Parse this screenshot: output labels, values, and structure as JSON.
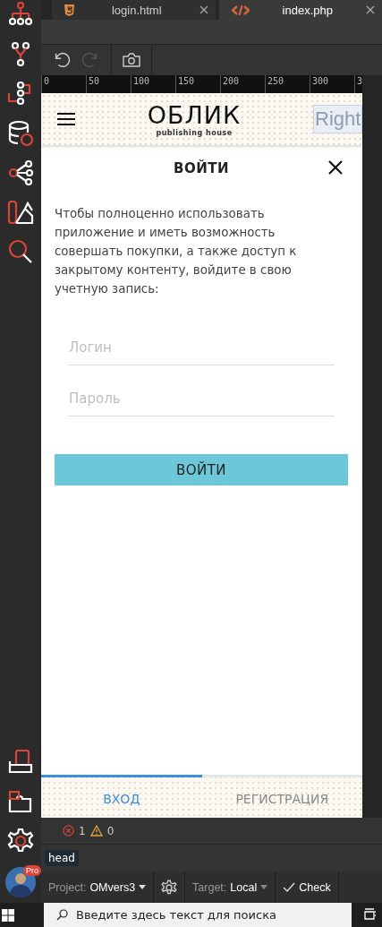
{
  "editor_tabs": [
    {
      "label": "login.html",
      "kind": "html",
      "selected": false
    },
    {
      "label": "index.php",
      "kind": "php",
      "selected": true
    }
  ],
  "history": [
    {
      "kind": "undo",
      "disabled": false
    },
    {
      "kind": "redo",
      "disabled": true
    }
  ],
  "ruler": [
    "0",
    "50",
    "100",
    "150",
    "200",
    "250",
    "300",
    "3"
  ],
  "preview": {
    "header": {
      "logo": "ОБЛИК",
      "tagline": "publishing house",
      "right_label": "Right"
    },
    "modal": {
      "title": "ВОЙТИ",
      "text": "Чтобы полноценно использовать приложение и иметь возможность совершать покупки, а также доступ к закрытому контенту, войдите в свою учетную запись:",
      "fields": [
        {
          "placeholder": "Логин"
        },
        {
          "placeholder": "Пароль"
        }
      ],
      "submit": "ВОЙТИ"
    },
    "auth_tabs": [
      {
        "label": "ВХОД",
        "selected": true
      },
      {
        "label": "РЕГИСТРАЦИЯ",
        "selected": false
      }
    ]
  },
  "problems": {
    "errors": "1",
    "warnings": "0"
  },
  "breadcrumb": [
    "head"
  ],
  "avatar_badge": "Pro",
  "bottom_bar": {
    "project_label": "Project:",
    "project": "OMvers3",
    "target_label": "Target:",
    "target": "Local",
    "check": "Check"
  },
  "taskbar": {
    "search_placeholder": "Введите здесь текст для поиска"
  }
}
